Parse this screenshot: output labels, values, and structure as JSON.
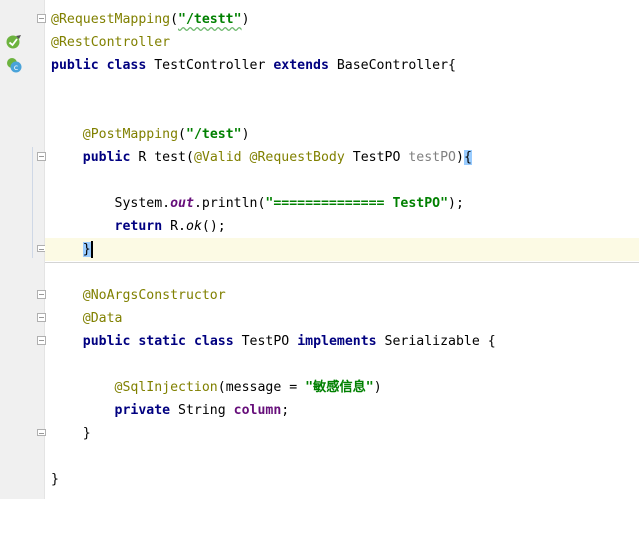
{
  "colors": {
    "keyword": "#000080",
    "annotation": "#808000",
    "string": "#008000",
    "parameter": "#808080",
    "field": "#660e7a",
    "current_line": "#fcfae4",
    "brace_match": "#99ccff"
  },
  "gutter_icons": [
    "spring-bean-icon",
    "class-implemented-icon"
  ],
  "code": {
    "l1": {
      "ann": "@RequestMapping",
      "p1": "(",
      "str": "\"/testt\"",
      "p2": ")"
    },
    "l2": {
      "ann": "@RestController"
    },
    "l3": {
      "kw1": "public",
      "kw2": "class",
      "name": " TestController ",
      "kw3": "extends",
      "rest": " BaseController{"
    },
    "l6": {
      "ann": "@PostMapping",
      "p1": "(",
      "str": "\"/test\"",
      "p2": ")"
    },
    "l7": {
      "kw": "public",
      "t1": " R test(",
      "ann1": "@Valid",
      "sp1": " ",
      "ann2": "@RequestBody",
      "t2": " TestPO ",
      "param": "testPO",
      "t3": ")",
      "brace": "{"
    },
    "l9": {
      "t1": "System.",
      "field": "out",
      "t2": ".println(",
      "str": "\"============== TestPO\"",
      "t3": ");"
    },
    "l10": {
      "kw": "return",
      "t1": " R.",
      "method": "ok",
      "t2": "();"
    },
    "l11": {
      "brace": "}"
    },
    "l13": {
      "ann": "@NoArgsConstructor"
    },
    "l14": {
      "ann": "@Data"
    },
    "l15": {
      "kw1": "public",
      "kw2": "static",
      "kw3": "class",
      "name": " TestPO ",
      "kw4": "implements",
      "rest": " Serializable {"
    },
    "l17": {
      "ann": "@SqlInjection",
      "t1": "(message = ",
      "str": "\"敏感信息\"",
      "t2": ")"
    },
    "l18": {
      "kw": "private",
      "t1": " String ",
      "field": "column",
      "t2": ";"
    },
    "l19": {
      "brace": "}"
    },
    "l21": {
      "brace": "}"
    }
  }
}
